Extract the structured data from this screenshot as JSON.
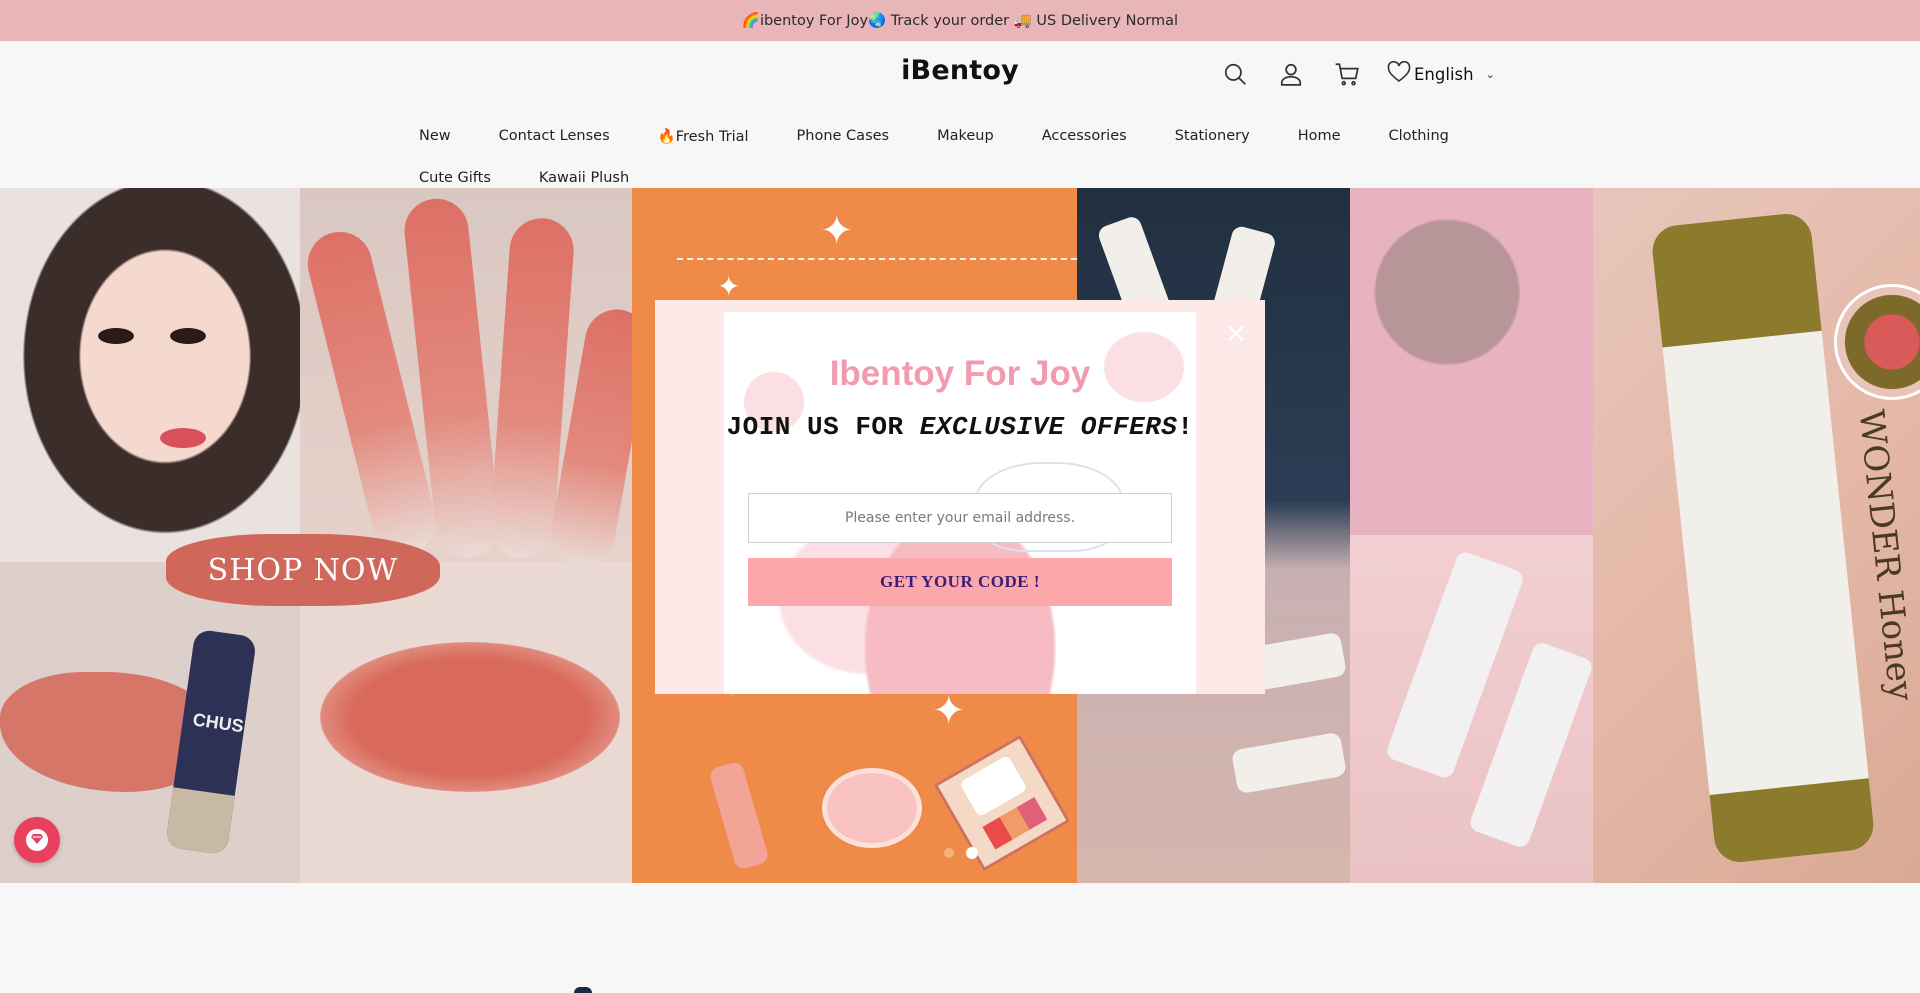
{
  "announcement": {
    "text": "🌈ibentoy For Joy🌏 Track your order 🚚 US Delivery Normal"
  },
  "header": {
    "logo": "iBentoy",
    "icons": [
      "search-icon",
      "account-icon",
      "cart-icon",
      "heart-icon"
    ],
    "language": "English"
  },
  "nav": {
    "row1": [
      "New",
      "Contact Lenses",
      "🔥Fresh Trial",
      "Phone Cases",
      "Makeup",
      "Accessories",
      "Stationery",
      "Home",
      "Clothing"
    ],
    "row2": [
      "Cute Gifts",
      "Kawaii Plush"
    ]
  },
  "hero": {
    "shop_now": "SHOP NOW",
    "tube_brand": "CHUS",
    "honey_label": "WONDER Honey",
    "slide_count": 2,
    "active_slide": 2
  },
  "popup": {
    "title": "Ibentoy For Joy",
    "subtitle_prefix": "JOIN US FOR ",
    "subtitle_emphasis": "EXCLUSIVE OFFERS",
    "subtitle_suffix": "!",
    "email_placeholder": "Please enter your email address.",
    "email_value": "",
    "button_label": "GET YOUR CODE !",
    "close_label": "×"
  },
  "colors": {
    "announcement_bg": "#e8b6b8",
    "popup_title": "#f29ab0",
    "button_bg": "#fca7a9",
    "button_text": "#3a1d7a",
    "hero_orange": "#f08a48",
    "gift_button": "#e94060"
  }
}
